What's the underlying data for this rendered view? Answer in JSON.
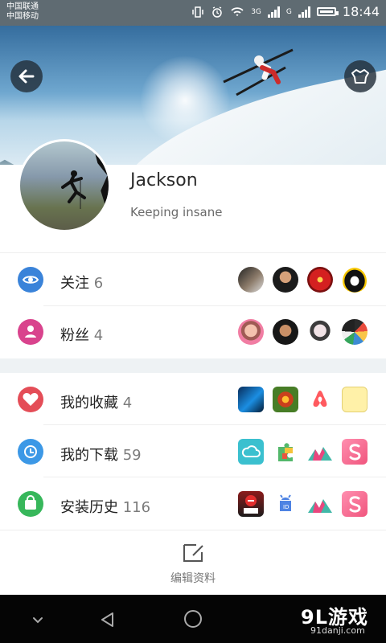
{
  "status_bar": {
    "carrier_1": "中国联通",
    "carrier_2": "中国移动",
    "network": "3G",
    "signal_2": "G",
    "time": "18:44"
  },
  "profile": {
    "name": "Jackson",
    "status": "Keeping insane"
  },
  "rows": [
    {
      "label": "关注",
      "count": "6",
      "icon": "eye-icon",
      "color": "#3a83d9"
    },
    {
      "label": "粉丝",
      "count": "4",
      "icon": "person-icon",
      "color": "#d9438d"
    },
    {
      "label": "我的收藏",
      "count": "4",
      "icon": "heart-icon",
      "color": "#e44d57"
    },
    {
      "label": "我的下载",
      "count": "59",
      "icon": "clock-icon",
      "color": "#3c98e6"
    },
    {
      "label": "安装历史",
      "count": "116",
      "icon": "shopping-bag-icon",
      "color": "#37b75b"
    }
  ],
  "bottom_action": {
    "label": "编辑资料",
    "icon": "edit-icon"
  },
  "navigation_bar": {
    "watermark": "9L游戏",
    "site": "91danji.com"
  },
  "icons": {
    "back": "arrow-left-icon",
    "shirt": "shirt-icon",
    "down": "chevron-down-icon",
    "nav_back": "triangle-back-icon",
    "home": "circle-home-icon"
  }
}
